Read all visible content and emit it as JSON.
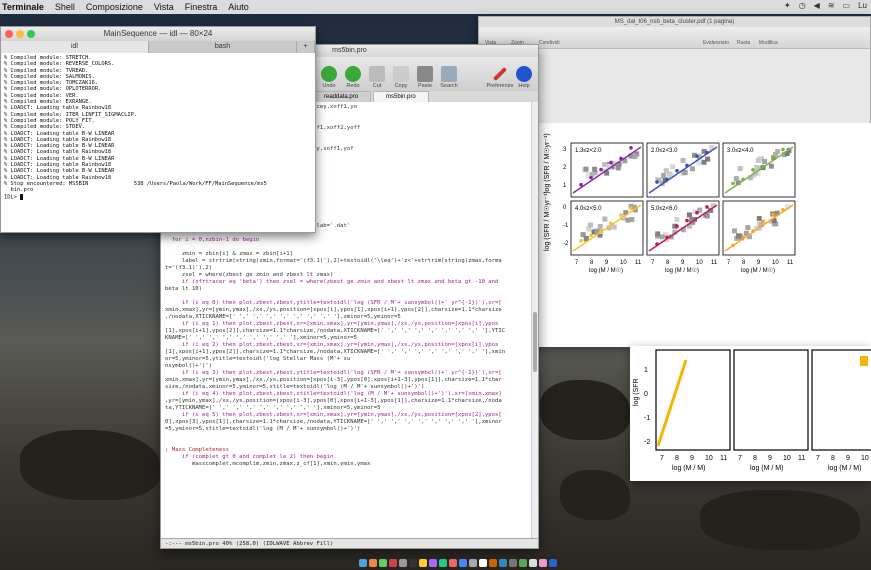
{
  "menubar": {
    "app": "Terminale",
    "items": [
      "Shell",
      "Composizione",
      "Vista",
      "Finestra",
      "Aiuto"
    ],
    "status_right": "Lu"
  },
  "terminal": {
    "title": "MainSequence — idl — 80×24",
    "tab_left": "idl",
    "tab_right": "bash",
    "lines": [
      "% Compiled module: STRETCH.",
      "% Compiled module: REVERSE_COLORS.",
      "% Compiled module: TVREAD.",
      "% Compiled module: SALMONIS.",
      "% Compiled module: TOMCZAK16.",
      "% Compiled module: OPLOTERROR.",
      "% Compiled module: VER.",
      "% Compiled module: EXRANGE.",
      "% LOADCT: Loading table Rainbow18",
      "% Compiled module: ITER_LINFIT_SIGMACLIP.",
      "% Compiled module: POLY_FIT.",
      "% Compiled module: STDEV.",
      "% LOADCT: Loading table B-W LINEAR",
      "% LOADCT: Loading table Rainbow18",
      "% LOADCT: Loading table B-W LINEAR",
      "% LOADCT: Loading table Rainbow18",
      "% LOADCT: Loading table B-W LINEAR",
      "% LOADCT: Loading table Rainbow18",
      "% LOADCT: Loading table B-W LINEAR",
      "% LOADCT: Loading table Rainbow18",
      "% Stop encountered: MS5BIN              538 /Users/Paola/Work/FF/MainSequence/ms5",
      "  bin.pro",
      "IDL> "
    ]
  },
  "editor": {
    "title": "ms5bin.pro",
    "tools": [
      "Undo",
      "Redo",
      "Cut",
      "Copy",
      "Paste",
      "Search",
      "Preferenze",
      "Help"
    ],
    "tabs": [
      "readdata.pro",
      "ms5bin.pro"
    ],
    "code": [
      "os,[mssmin,mssmax],[-2.5,3.7],npan,spacex,spacey,xoff1,yo",
      "",
      "",
      "os,[6,13],[-4,5],npan,spacex,spacey,xoff1,yoff1,xoff2,yoff",
      "",
      "",
      "os,[mssmin,mssmax],[-0.5,3],npan,spacex,spacey,xoff1,yof",
      "",
      "",
      "",
      "",
      "",
      "",
      "",
      "",
      "",
      "",
      "                                          eldlab='.dat'",
      "",
      "  for i = 0,nzbin-1 do begin",
      "",
      "     zmin = zbin[i] & zmax = zbin[i+1]",
      "     label = strtrim(string(zmin,format='(f3.1)'),2)+textoidl('\\leq')+'z<'+strtrim(string(zmax,forma",
      "t='(f3.1)'),2)",
      "     zsel = where(zbest ge zmin and zbest lt zmax)",
      "     if (sfrtracer eq 'beta') then zsel = where(zbest ge zmin and zbest lt zmax and beta gt -10 and",
      "beta lt 10)",
      "",
      "     if (i eq 0) then plot,zbest,zbest,ytitle=textoidl('log (SFR / M'+ sunsymbol()+' yr^{-1})'),xr=[",
      "xmin,xmax],yr=[ymin,ymax],/xs,/ys,position=[xpos[i],ypos[1],xpos[i+1],ypos[2]],charsize=1.1*charsize",
      ",/nodata,XTICKNAME=[' ',' ',' ',' ',' ',' ',' ',' '],xminor=5,yminor=5",
      "     if (i eq 1) then plot,zbest,zbest,xr=[xmin,xmax],yr=[ymin,ymax],/xs,/ys,position=[xpos[i],ypos",
      "[1],xpos[i+1],ypos[2]],charsize=1.1*charsize,/nodata,XTICKNAME=[' ',' ',' ',' ',' ',' ',' ',' '],YTIC",
      "KNAME=[' ',' ',' ',' ',' ',' ',' ',' '],xminor=5,yminor=5",
      "     if (i eq 2) then plot,zbest,zbest,xr=[xmin,xmax],yr=[ymin,ymax],/xs,/ys,position=[xpos[i],ypos",
      "[1],xpos[i+1],ypos[2]],charsize=1.1*charsize,/nodata,XTICKNAME=[' ',' ',' ',' ',' ',' ',' ',' '],xmin",
      "or=5,yminor=5,ytitle=textoidl('log Stellar Mass (M'+ su",
      "nsymbol()+')')",
      "     if (i eq 3) then plot,zbest,zbest,ytitle=textoidl('log (SFR / M'+ sunsymbol()+' yr^{-1})'),xr=[",
      "xmin,xmax],yr=[ymin,ymax],/xs,/ys,position=[xpos[i-3],ypos[0],xpos[i+1-3],ypos[1]],charsize=1.1*char",
      "size,/nodata,xminor=5,yminor=5,xtitle=textoidl('log (M / M'+ sunsymbol()+')')",
      "     if (i eq 4) then plot,zbest,zbest,xtitle=textoidl('log (M / M'+ sunsymbol()+')'),xr=[xmin,xmax]",
      ",yr=[ymin,ymax],/xs,/ys,position=[xpos[i-3],ypos[0],xpos[i+1-3],ypos[1]],charsize=1.1*charsize,/noda",
      "ta,YTICKNAME=[' ',' ',' ',' ',' ',' ',' ',' '],xminor=5,yminor=5",
      "     if (i eq 5) then plot,zbest,zbest,xr=[xmin,xmax],yr=[ymin,ymax],/xs,/ys,position=[xpos[2],ypos[",
      "0],xpos[3],ypos[1]],charsize=1.1*charsize,/nodata,YTICKNAME=[' ',' ',' ',' ',' ',' ',' ',' '],xminor",
      "=5,yminor=5,xtitle=textoidl('log (M / M'+ sunsymbol()+')')",
      "",
      "",
      "; Mass Completeness",
      "     if (complet gt 0 and complet le 2) then begin",
      "        masscomplet,mcomplim,zmin,zmax,z_cf[1],xmin,ymin,ymax"
    ],
    "status": "-:---  ms5bin.pro    40% (258,0)   (IDLWAVE Abbrev Fill)"
  },
  "pdf": {
    "title": "MS_dal_t06_nsb_beta_cluster.pdf (1 pagina)",
    "toolbar_left": "Vista",
    "toolbar_mid": "Zoom",
    "toolbar_share": "Condividi",
    "toolbar_right": [
      "Evidenziato",
      "Ruota",
      "Modifica"
    ],
    "panels": [
      "1.3≤z<2.0",
      "2.0≤z<3.0",
      "3.0≤z<4.0",
      "4.0≤z<5.0",
      "5.0≤z<6.0",
      ""
    ],
    "ylabel": "log (SFR / M☉yr⁻¹)",
    "xlabel": "log (M / M☉)",
    "xticks": [
      "7",
      "8",
      "9",
      "10",
      "11"
    ],
    "yticks": [
      "3",
      "2",
      "1",
      "0",
      "-1",
      "-2"
    ],
    "panel_colors": [
      "#8e24aa",
      "#3f51b5",
      "#7cb342",
      "#fbc02d",
      "#c2185b",
      "#f9a825"
    ]
  },
  "pdf2": {
    "ylabel": "log (SFR",
    "xlabel": "log (M / M)",
    "xticks": [
      "7",
      "8",
      "9",
      "10",
      "11"
    ],
    "yticks": [
      "1",
      "0",
      "-1",
      "-2"
    ]
  }
}
